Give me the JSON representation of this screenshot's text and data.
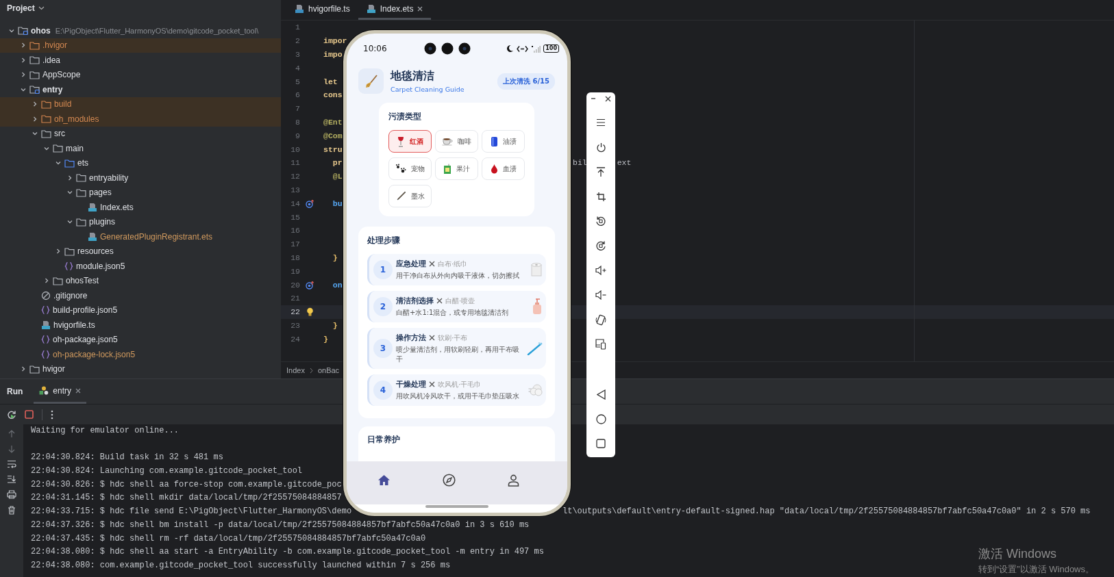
{
  "project_panel": {
    "title": "Project"
  },
  "tree": [
    {
      "label": "ohos",
      "kind": "module",
      "excluded": false,
      "ignored": false,
      "path": "E:\\PigObject\\Flutter_HarmonyOS\\demo\\gitcode_pocket_tool\\",
      "expanded": true,
      "children": [
        {
          "label": ".hvigor",
          "kind": "folder",
          "excluded": true,
          "ignored": false,
          "expanded": false
        },
        {
          "label": ".idea",
          "kind": "folder",
          "excluded": false,
          "ignored": false,
          "expanded": false
        },
        {
          "label": "AppScope",
          "kind": "folder",
          "excluded": false,
          "ignored": false,
          "expanded": false
        },
        {
          "label": "entry",
          "kind": "module",
          "excluded": false,
          "ignored": false,
          "expanded": true,
          "children": [
            {
              "label": "build",
              "kind": "folder",
              "excluded": true,
              "ignored": false,
              "expanded": false
            },
            {
              "label": "oh_modules",
              "kind": "folder",
              "excluded": true,
              "ignored": false,
              "expanded": false
            },
            {
              "label": "src",
              "kind": "folder",
              "excluded": false,
              "ignored": false,
              "expanded": true,
              "children": [
                {
                  "label": "main",
                  "kind": "folder",
                  "excluded": false,
                  "ignored": false,
                  "expanded": true,
                  "children": [
                    {
                      "label": "ets",
                      "kind": "source-folder",
                      "excluded": false,
                      "ignored": false,
                      "expanded": true,
                      "children": [
                        {
                          "label": "entryability",
                          "kind": "folder",
                          "excluded": false,
                          "ignored": false,
                          "expanded": false
                        },
                        {
                          "label": "pages",
                          "kind": "folder",
                          "excluded": false,
                          "ignored": false,
                          "expanded": true,
                          "children": [
                            {
                              "label": "Index.ets",
                              "kind": "file-ets",
                              "excluded": false,
                              "ignored": false
                            }
                          ]
                        },
                        {
                          "label": "plugins",
                          "kind": "folder",
                          "excluded": false,
                          "ignored": false,
                          "expanded": true,
                          "children": [
                            {
                              "label": "GeneratedPluginRegistrant.ets",
                              "kind": "file-ets",
                              "excluded": false,
                              "ignored": true
                            }
                          ]
                        }
                      ]
                    },
                    {
                      "label": "resources",
                      "kind": "folder",
                      "excluded": false,
                      "ignored": false,
                      "expanded": false
                    },
                    {
                      "label": "module.json5",
                      "kind": "json",
                      "excluded": false,
                      "ignored": false
                    }
                  ]
                },
                {
                  "label": "ohosTest",
                  "kind": "folder",
                  "excluded": false,
                  "ignored": false,
                  "expanded": false
                }
              ]
            },
            {
              "label": ".gitignore",
              "kind": "gitignore",
              "excluded": false,
              "ignored": false
            },
            {
              "label": "build-profile.json5",
              "kind": "json",
              "excluded": false,
              "ignored": false
            },
            {
              "label": "hvigorfile.ts",
              "kind": "file-ts",
              "excluded": false,
              "ignored": false
            },
            {
              "label": "oh-package.json5",
              "kind": "json",
              "excluded": false,
              "ignored": false
            },
            {
              "label": "oh-package-lock.json5",
              "kind": "json",
              "excluded": false,
              "ignored": true
            }
          ]
        },
        {
          "label": "hvigor",
          "kind": "folder",
          "excluded": false,
          "ignored": false,
          "expanded": false
        }
      ]
    }
  ],
  "editor_tabs": [
    {
      "label": "hvigorfile.ts",
      "kind": "ts",
      "selected": false
    },
    {
      "label": "Index.ets",
      "kind": "ets",
      "selected": true
    }
  ],
  "code_lines": [
    {
      "number": "1",
      "current": false
    },
    {
      "number": "2",
      "code": "impor",
      "kind": "keyword",
      "current": false
    },
    {
      "number": "3",
      "code": "impo",
      "kind": "keyword",
      "current": false
    },
    {
      "number": "4",
      "current": false
    },
    {
      "number": "5",
      "code": "let",
      "kind": "keyword",
      "current": false
    },
    {
      "number": "6",
      "code": "cons",
      "kind": "keyword",
      "current": false
    },
    {
      "number": "7",
      "current": false
    },
    {
      "number": "8",
      "code": "@Ent",
      "kind": "decorator",
      "current": false
    },
    {
      "number": "9",
      "code": "@Com",
      "kind": "decorator",
      "current": false
    },
    {
      "number": "10",
      "code": "stru",
      "kind": "keyword",
      "current": false
    },
    {
      "number": "11",
      "code": "  pr",
      "kind": "keyword",
      "tail": [
        "bil",
        "ext"
      ],
      "current": false
    },
    {
      "number": "12",
      "code": "  @L",
      "kind": "decorator",
      "current": false
    },
    {
      "number": "13",
      "current": false
    },
    {
      "number": "14",
      "code": "  bu",
      "kind": "function",
      "override": true,
      "current": false
    },
    {
      "number": "15",
      "current": false
    },
    {
      "number": "16",
      "current": false
    },
    {
      "number": "17",
      "current": false
    },
    {
      "number": "18",
      "code": "  }",
      "kind": "bracket",
      "current": false
    },
    {
      "number": "19",
      "current": false
    },
    {
      "number": "20",
      "code": "  on",
      "kind": "function",
      "override": true,
      "current": false
    },
    {
      "number": "21",
      "current": false
    },
    {
      "number": "22",
      "bulb": true,
      "current": true
    },
    {
      "number": "23",
      "code": "  }",
      "kind": "bracket",
      "current": false
    },
    {
      "number": "24",
      "code": "}",
      "kind": "bracket",
      "current": false
    }
  ],
  "breadcrumb": [
    "Index",
    "onBac"
  ],
  "run_panel": {
    "title": "Run",
    "tabs": [
      {
        "label": "entry",
        "selected": true
      }
    ]
  },
  "console": {
    "status": "Waiting for emulator online...",
    "lines": [
      {
        "text": "22:04:30.824: Build task in 32 s 481 ms"
      },
      {
        "text": "22:04:30.824: Launching com.example.gitcode_pocket_tool"
      },
      {
        "text": "22:04:30.826: $ hdc shell aa force-stop com.example.gitcode_poc"
      },
      {
        "text": "22:04:31.145: $ hdc shell mkdir data/local/tmp/2f25575084884857"
      },
      {
        "text": "22:04:33.715: $ hdc file send E:\\PigObject\\Flutter_HarmonyOS\\demo",
        "tail": "lt\\outputs\\default\\entry-default-signed.hap \"data/local/tmp/2f25575084884857bf7abfc50a47c0a0\" in 2 s 570 ms"
      },
      {
        "text": "22:04:37.326: $ hdc shell bm install -p data/local/tmp/2f25575084884857bf7abfc50a47c0a0 in 3 s 610 ms"
      },
      {
        "text": "22:04:37.435: $ hdc shell rm -rf data/local/tmp/2f25575084884857bf7abfc50a47c0a0"
      },
      {
        "text": "22:04:38.080: $ hdc shell aa start -a EntryAbility -b com.example.gitcode_pocket_tool -m entry in 497 ms"
      },
      {
        "text": "22:04:38.080: com.example.gitcode_pocket_tool successfully launched within 7 s 256 ms"
      }
    ]
  },
  "phone": {
    "status_bar": {
      "time": "10:06",
      "battery": "100"
    },
    "header": {
      "title": "地毯清洁",
      "subtitle": "Carpet Cleaning Guide",
      "badge": "上次清洗 6/15"
    },
    "stains": {
      "title": "污渍类型",
      "items": [
        {
          "label": "红酒",
          "kind": "wine",
          "selected": true
        },
        {
          "label": "咖啡",
          "kind": "coffee",
          "selected": false
        },
        {
          "label": "油渍",
          "kind": "can",
          "selected": false
        },
        {
          "label": "宠物",
          "kind": "paw",
          "selected": false
        },
        {
          "label": "果汁",
          "kind": "juice",
          "selected": false
        },
        {
          "label": "血渍",
          "kind": "drop",
          "selected": false
        },
        {
          "label": "墨水",
          "kind": "pen",
          "selected": false
        }
      ]
    },
    "steps": {
      "title": "处理步骤",
      "items": [
        {
          "number": "1",
          "title": "应急处理",
          "tools": "白布·纸巾",
          "description": "用干净白布从外向内吸干液体，切勿擦拭",
          "kind": "roll"
        },
        {
          "number": "2",
          "title": "清洁剂选择",
          "tools": "白醋·喷壶",
          "description": "白醋+水1:1混合，或专用地毯清洁剂",
          "kind": "bottle"
        },
        {
          "number": "3",
          "title": "操作方法",
          "tools": "软刷·干布",
          "description": "喷少量清洁剂，用软刷轻刷，再用干布吸干",
          "kind": "brush"
        },
        {
          "number": "4",
          "title": "干燥处理",
          "tools": "吹风机·干毛巾",
          "description": "用吹风机冷风吹干，或用干毛巾垫压吸水",
          "kind": "wind"
        }
      ]
    },
    "daily_care": {
      "title": "日常养护"
    },
    "nav": [
      {
        "kind": "home",
        "selected": true
      },
      {
        "kind": "compass",
        "selected": false
      },
      {
        "kind": "person",
        "selected": false
      }
    ]
  },
  "os_notice": {
    "title": "激活 Windows",
    "subtitle": "转到“设置”以激活 Windows。"
  }
}
